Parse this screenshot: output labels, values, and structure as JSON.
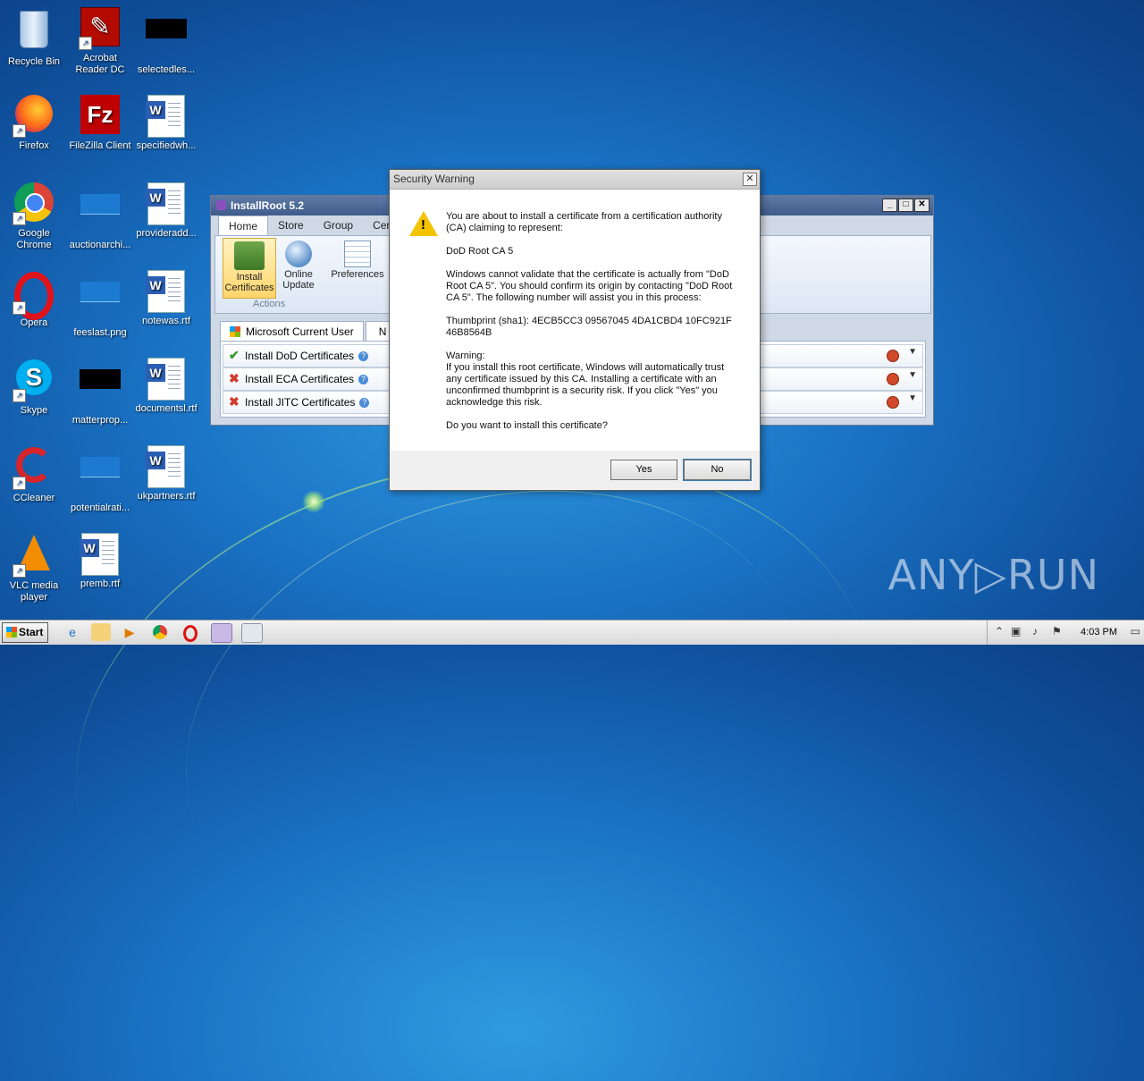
{
  "desktop": {
    "icons": [
      {
        "label": "Recycle Bin"
      },
      {
        "label": "Acrobat Reader DC"
      },
      {
        "label": "selectedles..."
      },
      {
        "label": "Firefox"
      },
      {
        "label": "FileZilla Client"
      },
      {
        "label": "specifiedwh..."
      },
      {
        "label": "Google Chrome"
      },
      {
        "label": "auctionarchi..."
      },
      {
        "label": "provideradd..."
      },
      {
        "label": "Opera"
      },
      {
        "label": "feeslast.png"
      },
      {
        "label": "notewas.rtf"
      },
      {
        "label": "Skype"
      },
      {
        "label": "matterprop..."
      },
      {
        "label": "documentsl.rtf"
      },
      {
        "label": "CCleaner"
      },
      {
        "label": "potentialrati..."
      },
      {
        "label": "ukpartners.rtf"
      },
      {
        "label": "VLC media player"
      },
      {
        "label": "premb.rtf"
      }
    ]
  },
  "installroot": {
    "title": "InstallRoot 5.2",
    "tabs": [
      "Home",
      "Store",
      "Group",
      "Cert"
    ],
    "buttons": {
      "install": "Install Certificates",
      "update": "Online Update",
      "preferences": "Preferences"
    },
    "group_actions": "Actions",
    "cert_tabs": [
      "Microsoft Current User",
      "N"
    ],
    "rows": [
      {
        "label": "Install DoD Certificates",
        "status": "ok"
      },
      {
        "label": "Install ECA Certificates",
        "status": "x"
      },
      {
        "label": "Install JITC Certificates",
        "status": "x"
      }
    ],
    "status_ok": "✔",
    "status_x": "✖"
  },
  "dialog": {
    "title": "Security Warning",
    "para1": "You are about to install a certificate from a certification authority (CA) claiming to represent:",
    "ca_name": "DoD Root CA 5",
    "para2": "Windows cannot validate that the certificate is actually from \"DoD Root CA 5\". You should confirm its origin by contacting \"DoD Root CA 5\". The following number will assist you in this process:",
    "thumbprint": "Thumbprint (sha1): 4ECB5CC3 09567045 4DA1CBD4 10FC921F 46B8564B",
    "warning_head": "Warning:",
    "warning_text": "If you install this root certificate, Windows will automatically trust any certificate issued by this CA. Installing a certificate with an unconfirmed thumbprint is a security risk. If you click \"Yes\" you acknowledge this risk.",
    "question": "Do you want to install this certificate?",
    "yes": "Yes",
    "no": "No"
  },
  "watermark": "ANY▷RUN",
  "taskbar": {
    "start": "Start",
    "clock": "4:03 PM"
  }
}
